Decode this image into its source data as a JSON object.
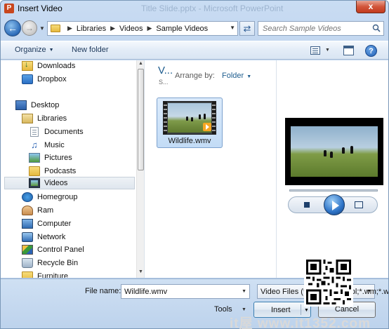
{
  "window": {
    "title": "Insert Video",
    "app_icon_letter": "P",
    "background_title": "Title Slide.pptx - Microsoft PowerPoint",
    "close_glyph": "x"
  },
  "nav": {
    "back_glyph": "←",
    "forward_glyph": "→",
    "breadcrumb": [
      "Libraries",
      "Videos",
      "Sample Videos"
    ],
    "search_placeholder": "Search Sample Videos",
    "refresh_glyph": "⇄"
  },
  "toolbar": {
    "organize_label": "Organize",
    "new_folder_label": "New folder",
    "help_glyph": "?"
  },
  "sidebar": {
    "items": [
      {
        "label": "Downloads",
        "icon": "downloads-icon"
      },
      {
        "label": "Dropbox",
        "icon": "dropbox-icon"
      },
      {
        "label": "Desktop",
        "icon": "desktop-icon"
      },
      {
        "label": "Libraries",
        "icon": "libraries-icon"
      },
      {
        "label": "Documents",
        "icon": "documents-icon"
      },
      {
        "label": "Music",
        "icon": "music-icon"
      },
      {
        "label": "Pictures",
        "icon": "pictures-icon"
      },
      {
        "label": "Podcasts",
        "icon": "folder-icon"
      },
      {
        "label": "Videos",
        "icon": "videos-icon",
        "selected": true
      },
      {
        "label": "Homegroup",
        "icon": "homegroup-icon"
      },
      {
        "label": "Ram",
        "icon": "user-icon"
      },
      {
        "label": "Computer",
        "icon": "computer-icon"
      },
      {
        "label": "Network",
        "icon": "network-icon"
      },
      {
        "label": "Control Panel",
        "icon": "control-panel-icon"
      },
      {
        "label": "Recycle Bin",
        "icon": "recycle-bin-icon"
      },
      {
        "label": "Furniture",
        "icon": "folder-icon"
      }
    ]
  },
  "content": {
    "library_title": "V...",
    "library_subtitle": "S...",
    "arrange_by_label": "Arrange by:",
    "arrange_by_value": "Folder",
    "files": [
      {
        "name": "Wildlife.wmv",
        "selected": true
      }
    ]
  },
  "footer": {
    "file_name_label": "File name:",
    "file_name_value": "Wildlife.wmv",
    "file_type_value": "Video Files (*.asf;*.asx;*.wpl;*.wm;*.w",
    "tools_label": "Tools",
    "insert_label": "Insert",
    "cancel_label": "Cancel"
  },
  "watermark": {
    "text": "it屋 www.it1352.com"
  },
  "colors": {
    "accent": "#1e5d8f",
    "chrome": "#b6cde9",
    "close": "#c23a1e"
  }
}
